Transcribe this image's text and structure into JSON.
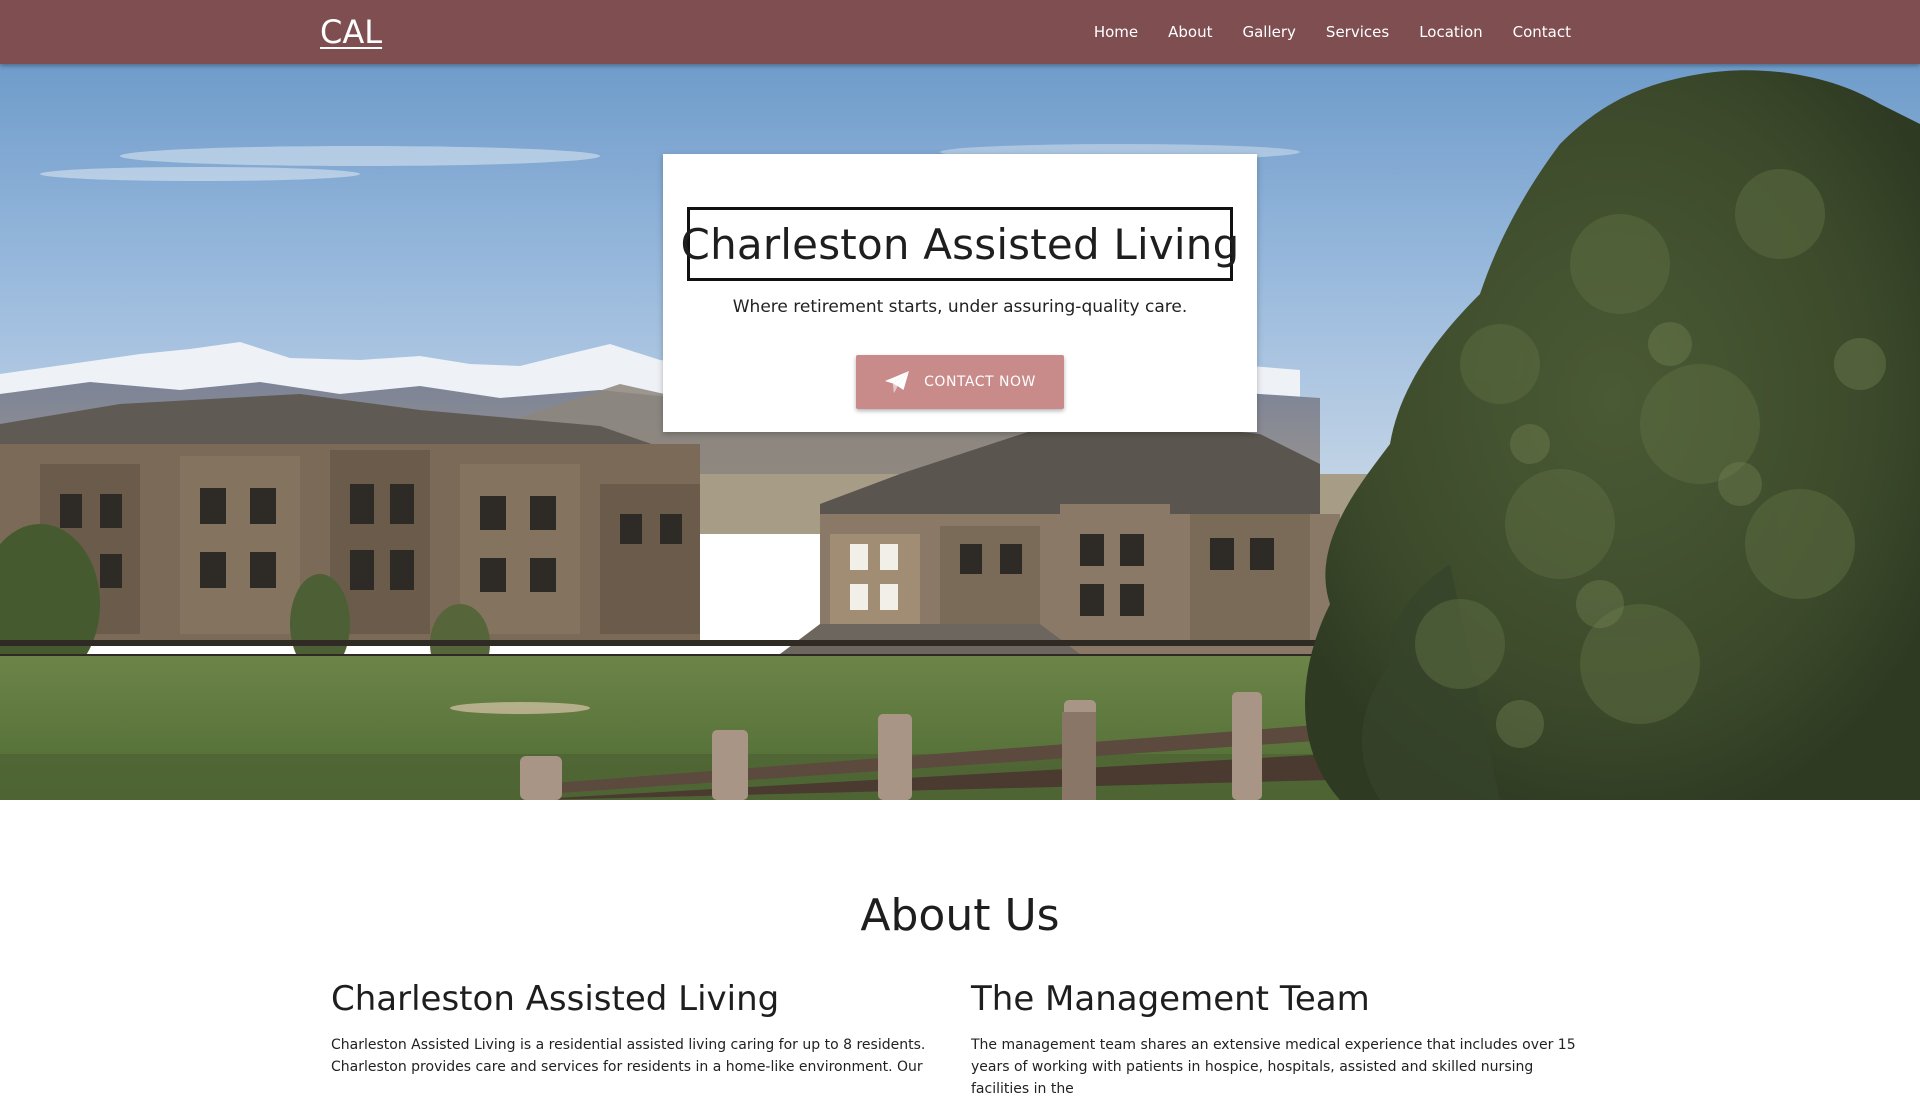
{
  "nav": {
    "brand": "CAL",
    "links": [
      "Home",
      "About",
      "Gallery",
      "Services",
      "Location",
      "Contact"
    ]
  },
  "hero": {
    "title": "Charleston Assisted Living",
    "tagline": "Where retirement starts, under assuring-quality care.",
    "cta_label": "CONTACT NOW",
    "cta_icon": "paper-plane-icon"
  },
  "about": {
    "heading": "About Us",
    "left": {
      "title": "Charleston Assisted Living",
      "text": "Charleston Assisted Living is a residential assisted living caring for up to 8 residents. Charleston provides care and services for residents in a home-like environment. Our"
    },
    "right": {
      "title": "The Management Team",
      "text": "The management team shares an extensive medical experience that includes over 15 years of working with patients in hospice, hospitals, assisted and skilled nursing facilities in the"
    }
  },
  "colors": {
    "navbar": "#7e4e51",
    "cta": "#c98a8a"
  }
}
